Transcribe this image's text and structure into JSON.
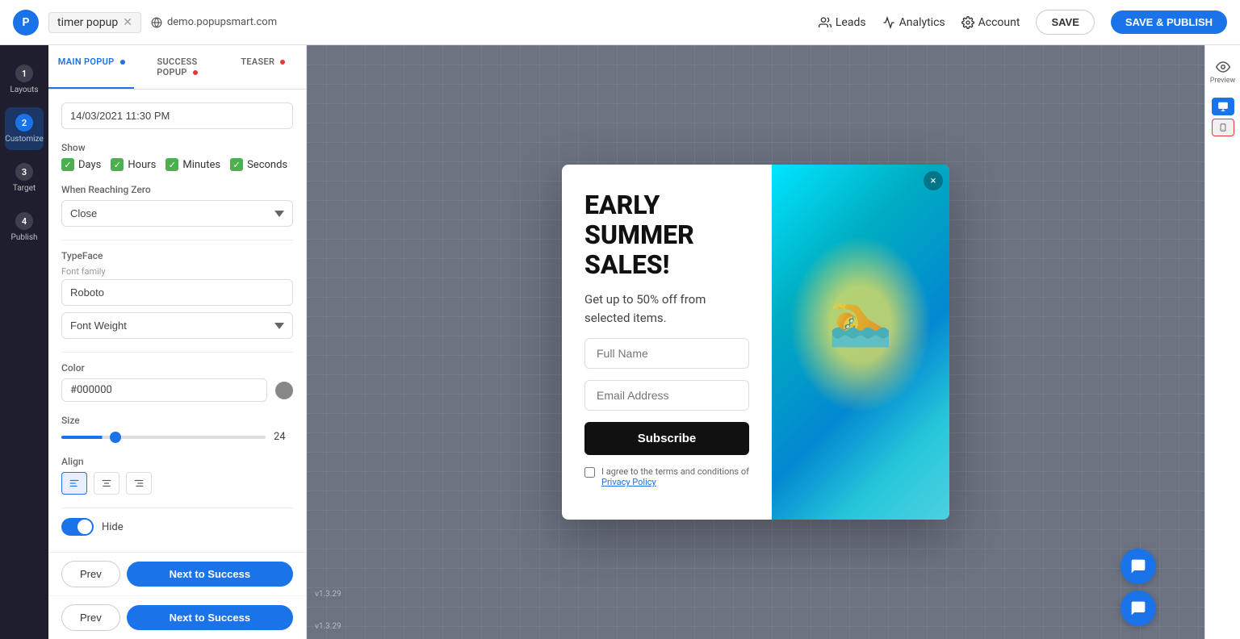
{
  "app": {
    "logo_text": "P",
    "project_name": "timer popup",
    "preview_url": "demo.popupsmart.com",
    "version": "v1.3.29"
  },
  "nav": {
    "leads_label": "Leads",
    "analytics_label": "Analytics",
    "account_label": "Account",
    "save_label": "SAVE",
    "save_publish_label": "SAVE & PUBLISH"
  },
  "sidebar": {
    "items": [
      {
        "step": "1",
        "label": "Layouts"
      },
      {
        "step": "2",
        "label": "Customize"
      },
      {
        "step": "3",
        "label": "Target"
      },
      {
        "step": "4",
        "label": "Publish"
      }
    ]
  },
  "panel": {
    "tabs": [
      {
        "key": "main",
        "label": "MAIN POPUP",
        "dot": "blue",
        "active": true
      },
      {
        "key": "success",
        "label": "SUCCESS POPUP",
        "dot": "red",
        "active": false
      },
      {
        "key": "teaser",
        "label": "TEASER",
        "dot": "red",
        "active": false
      }
    ],
    "datetime_value": "14/03/2021 11:30 PM",
    "show_label": "Show",
    "show_options": [
      "Days",
      "Hours",
      "Minutes",
      "Seconds"
    ],
    "when_zero_label": "When Reaching Zero",
    "when_zero_value": "Close",
    "typeface_label": "TypeFace",
    "font_family_label": "Font family",
    "font_family_value": "Roboto",
    "font_weight_label": "Font Weight",
    "color_label": "Color",
    "color_value": "#000000",
    "size_label": "Size",
    "size_value": "24",
    "align_label": "Align",
    "hide_label": "Hide",
    "hide_toggle": true
  },
  "footer": {
    "prev_label": "Prev",
    "next_label": "Next to Success",
    "prev_label_2": "Prev",
    "next_label_2": "Next to Success"
  },
  "popup": {
    "title": "EARLY SUMMER SALES!",
    "subtitle": "Get up to 50% off from selected items.",
    "fullname_placeholder": "Full Name",
    "email_placeholder": "Email Address",
    "subscribe_label": "Subscribe",
    "terms_text": "I agree to the terms and conditions of",
    "terms_link": "Privacy Policy",
    "close_icon": "×"
  },
  "right_panel": {
    "preview_label": "Preview",
    "desktop_icon": "🖥",
    "mobile_icon": "📱"
  },
  "colors": {
    "accent": "#1a73e8",
    "dark_bg": "#1e1e2e",
    "danger": "#e53935",
    "success": "#4caf50"
  }
}
